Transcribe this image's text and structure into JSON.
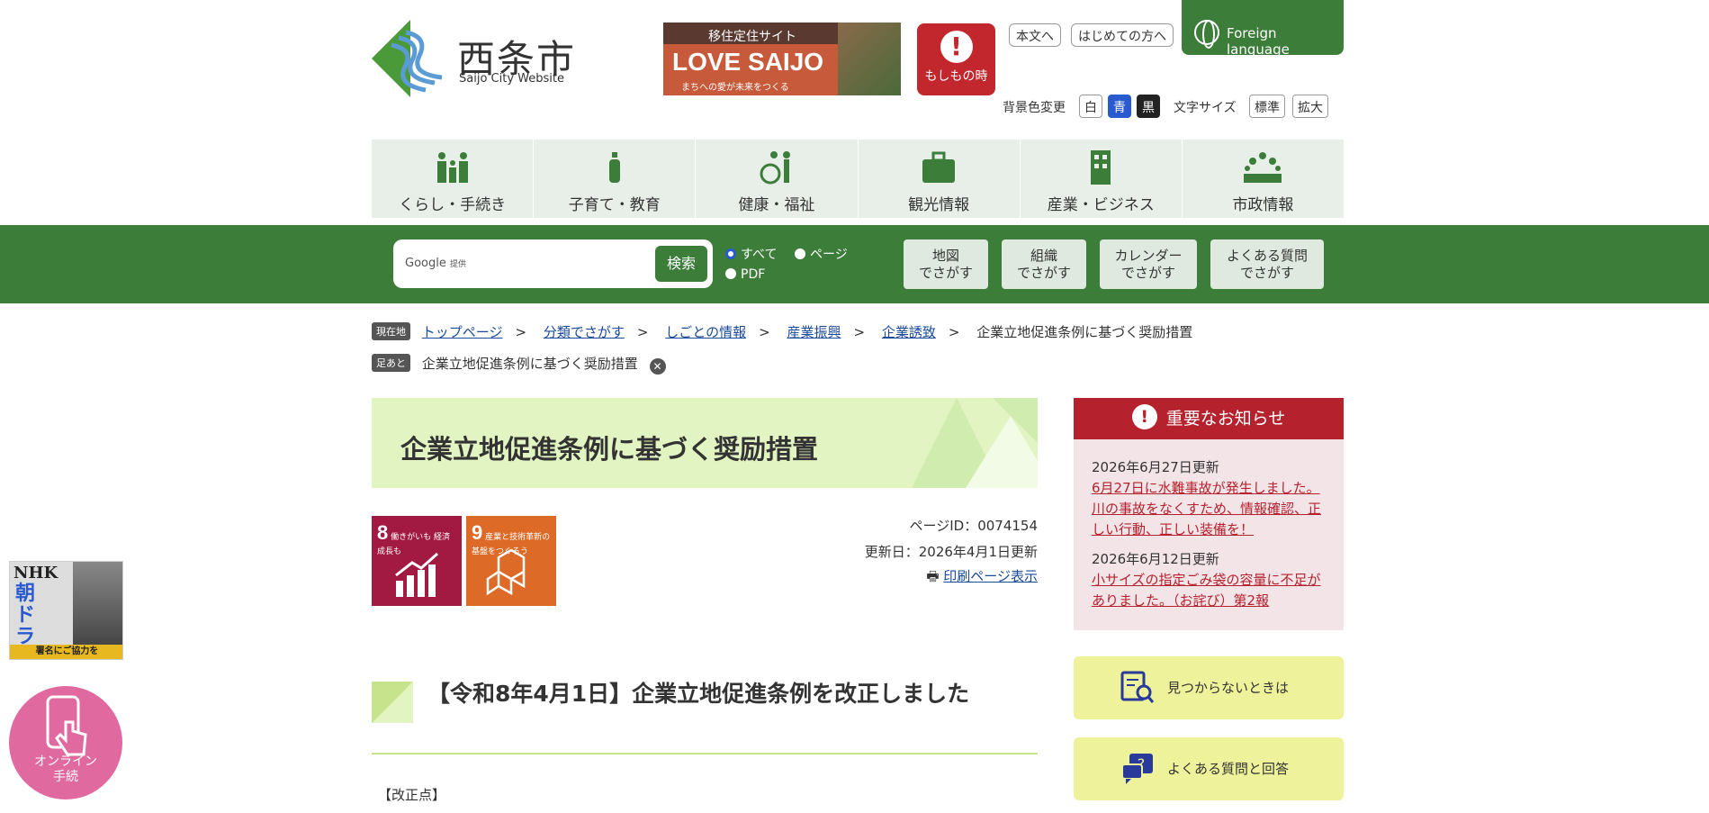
{
  "header": {
    "logo_title": "西条市",
    "logo_subtitle": "Saijo City Website",
    "banner": {
      "top": "移住定住サイト",
      "main": "LOVE SAIJO",
      "sub": "まちへの愛が未来をつくる"
    },
    "emergency_label": "もしもの時",
    "skip_to_content": "本文へ",
    "first_visitors": "はじめての方へ",
    "foreign_language": "Foreign language",
    "bg_color_label": "背景色変更",
    "bg_white": "白",
    "bg_blue": "青",
    "bg_black": "黒",
    "font_size_label": "文字サイズ",
    "font_standard": "標準",
    "font_large": "拡大"
  },
  "categories": [
    {
      "label": "くらし・手続き",
      "icon": "family-icon"
    },
    {
      "label": "子育て・教育",
      "icon": "baby-bottle-icon"
    },
    {
      "label": "健康・福祉",
      "icon": "wheelchair-icon"
    },
    {
      "label": "観光情報",
      "icon": "suitcase-icon"
    },
    {
      "label": "産業・ビジネス",
      "icon": "building-icon"
    },
    {
      "label": "市政情報",
      "icon": "people-icon"
    }
  ],
  "search": {
    "google_label": "Google",
    "provider": "提供",
    "button": "検索",
    "opt_all": "すべて",
    "opt_page": "ページ",
    "opt_pdf": "PDF",
    "map": "地図\nでさがす",
    "org": "組織\nでさがす",
    "calendar": "カレンダー\nでさがす",
    "faq": "よくある質問\nでさがす"
  },
  "breadcrumb": {
    "current_tag": "現在地",
    "items": [
      "トップページ",
      "分類でさがす",
      "しごとの情報",
      "産業振興",
      "企業誘致"
    ],
    "current": "企業立地促進条例に基づく奨励措置",
    "history_tag": "足あと",
    "history_item": "企業立地促進条例に基づく奨励措置"
  },
  "page": {
    "title": "企業立地促進条例に基づく奨励措置",
    "sdg8_num": "8",
    "sdg8_text": "働きがいも 経済成長も",
    "sdg9_num": "9",
    "sdg9_text": "産業と技術革新の 基盤をつくろう",
    "page_id": "ページID：0074154",
    "updated": "更新日：2026年4月1日更新",
    "print": "印刷ページ表示",
    "section_title": "【令和8年4月1日】企業立地促進条例を改正しました",
    "kaisei": "【改正点】"
  },
  "notice": {
    "title": "重要なお知らせ",
    "items": [
      {
        "date": "2026年6月27日更新",
        "text": "6月27日に水難事故が発生しました。 川の事故をなくすため、情報確認、正しい行動、正しい装備を！"
      },
      {
        "date": "2026年6月12日更新",
        "text": "小サイズの指定ごみ袋の容量に不足がありました。（お詫び）第2報"
      }
    ]
  },
  "side_links": {
    "not_found": "見つからないときは",
    "faq": "よくある質問と回答"
  },
  "floating": {
    "asadora_top": "NHK",
    "asadora_main": "朝ドラ",
    "asadora_bottom": "署名にご協力を",
    "online": "オンライン\n手続"
  },
  "colors": {
    "green": "#3d7d3a",
    "notice_red": "#b5222e",
    "title_bg": "#e1f4c2"
  }
}
